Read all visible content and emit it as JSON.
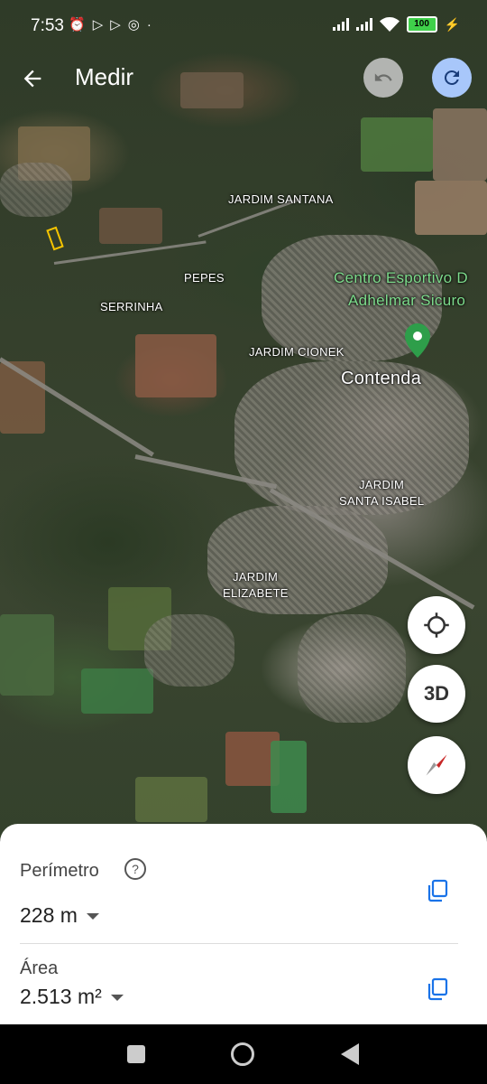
{
  "status_bar": {
    "time": "7:53",
    "battery": "100",
    "notification_icons": [
      "alarm-icon",
      "play-icon",
      "play-icon",
      "instagram-icon",
      "dot-icon"
    ]
  },
  "top_bar": {
    "title": "Medir",
    "back_icon": "arrow-back-icon",
    "undo_icon": "undo-icon",
    "redo_icon": "redo-icon"
  },
  "map": {
    "labels": {
      "jardim_santana": "JARDIM SANTANA",
      "pepes": "PEPES",
      "serrinha": "SERRINHA",
      "jardim_cionek": "JARDIM CIONEK",
      "contenda": "Contenda",
      "jardim_santa_isabel_1": "JARDIM",
      "jardim_santa_isabel_2": "SANTA ISABEL",
      "jardim_elizabete_1": "JARDIM",
      "jardim_elizabete_2": "ELIZABETE",
      "poi_line1": "Centro Esportivo D",
      "poi_line2": "Adhelmar Sicuro"
    },
    "poi_color": "#2e9e4a"
  },
  "controls": {
    "locate_icon": "my-location-icon",
    "three_d_label": "3D",
    "compass_icon": "compass-icon"
  },
  "sheet": {
    "perimeter_label": "Perímetro",
    "perimeter_value": "228 m",
    "area_label": "Área",
    "area_value": "2.513 m²",
    "copy_color": "#1a73e8"
  },
  "nav_bar": {
    "buttons": [
      "recents-icon",
      "home-icon",
      "back-icon"
    ]
  }
}
